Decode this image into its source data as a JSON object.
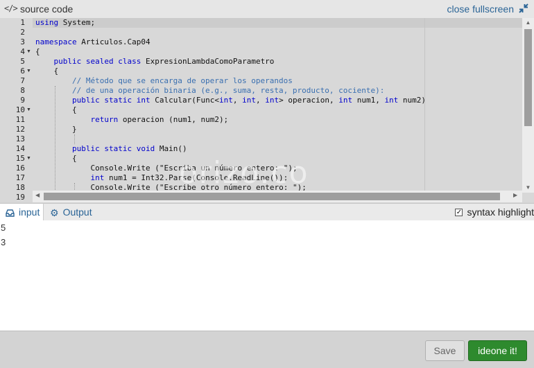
{
  "header": {
    "title": "source code",
    "fullscreen_label": "close fullscreen"
  },
  "editor": {
    "line_numbers": [
      "1",
      "2",
      "3",
      "4",
      "5",
      "6",
      "7",
      "8",
      "9",
      "10",
      "11",
      "12",
      "13",
      "14",
      "15",
      "16",
      "17",
      "18",
      "19"
    ],
    "lines": [
      "using System;",
      "",
      "namespace Articulos.Cap04",
      "{",
      "    public sealed class ExpresionLambdaComoParametro",
      "    {",
      "        // Método que se encarga de operar los operandos",
      "        // de una operación binaria (e.g., suma, resta, producto, cociente):",
      "        public static int Calcular(Func<int, int, int> operacion, int num1, int num2)",
      "        {",
      "            return operacion (num1, num2);",
      "        }",
      "",
      "        public static void Main()",
      "        {",
      "            Console.Write (\"Escriba un número entero: \");",
      "            int num1 = Int32.Parse(Console.ReadLine());",
      "            Console.Write (\"Escribe otro número entero: \");",
      ""
    ],
    "keywords": [
      "using",
      "namespace",
      "public",
      "sealed",
      "class",
      "static",
      "int",
      "return",
      "void"
    ],
    "colors": {
      "keyword": "#0000cc",
      "comment": "#3a6fb0",
      "text": "#111111"
    }
  },
  "watermark": "orizo.co",
  "tabs": {
    "input_label": "input",
    "output_label": "Output",
    "syntax_label": "syntax highlight",
    "syntax_checked": true
  },
  "input": {
    "lines": [
      "5",
      "3"
    ]
  },
  "buttons": {
    "save_label": "Save",
    "run_label": "ideone it!"
  },
  "colors": {
    "run_button": "#2e8a2e",
    "link": "#2a6496"
  }
}
